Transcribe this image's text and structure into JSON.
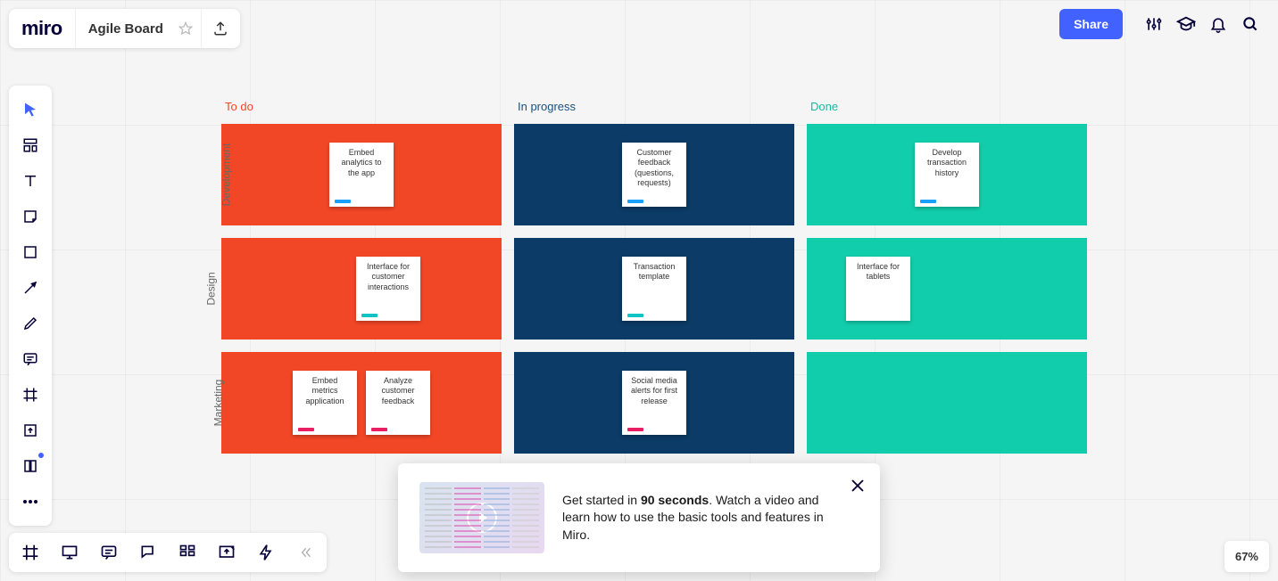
{
  "app": {
    "logo": "miro",
    "board_title": "Agile Board"
  },
  "header": {
    "share_label": "Share"
  },
  "zoom": "67%",
  "board": {
    "columns": [
      {
        "label": "To do",
        "color": "#f24726"
      },
      {
        "label": "In progress",
        "color": "#1a5080"
      },
      {
        "label": "Done",
        "color": "#0fbfa0"
      }
    ],
    "rows": [
      {
        "label": "Development"
      },
      {
        "label": "Design"
      },
      {
        "label": "Marketing"
      }
    ],
    "cards": {
      "r0c0": [
        {
          "text": "Embed analytics to the app",
          "tag": "blue"
        }
      ],
      "r0c1": [
        {
          "text": "Customer feedback (questions, requests)",
          "tag": "blue"
        }
      ],
      "r0c2": [
        {
          "text": "Develop transaction history",
          "tag": "blue"
        }
      ],
      "r1c0": [
        {
          "text": "Interface for customer interactions",
          "tag": "cyan"
        }
      ],
      "r1c1": [
        {
          "text": "Transaction template",
          "tag": "cyan"
        }
      ],
      "r1c2": [
        {
          "text": "Interface for tablets",
          "tag": ""
        }
      ],
      "r2c0": [
        {
          "text": "Embed metrics application",
          "tag": "pink"
        },
        {
          "text": "Analyze customer feedback",
          "tag": "pink"
        }
      ],
      "r2c1": [
        {
          "text": "Social media alerts for first release",
          "tag": "pink"
        }
      ],
      "r2c2": []
    }
  },
  "tutorial": {
    "text_prefix": "Get started in ",
    "text_bold": "90 seconds",
    "text_suffix": ". Watch a video and learn how to use the basic tools and features in Miro."
  }
}
